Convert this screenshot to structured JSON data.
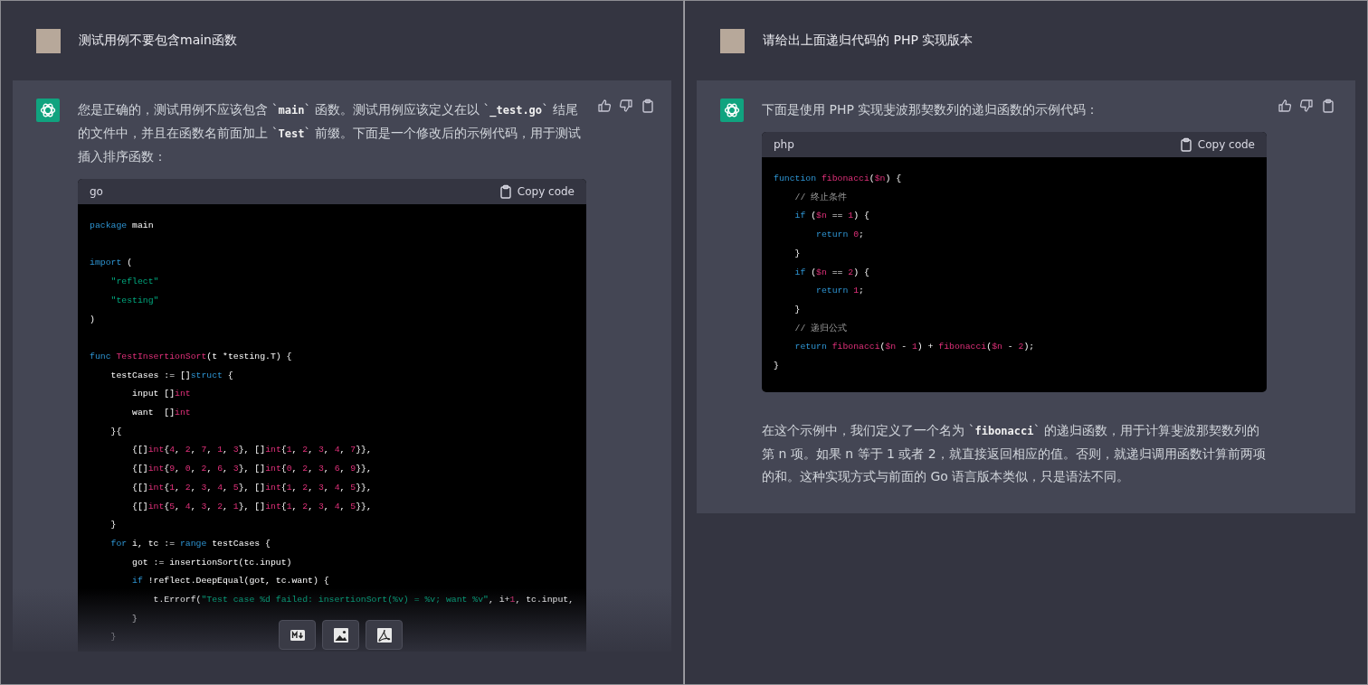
{
  "panels": [
    {
      "user_message": "测试用例不要包含main函数",
      "reply": {
        "intro": "您是正确的，测试用例不应该包含 `**main**` 函数。测试用例应该定义在以 `**_test.go**` 结尾的文件中，并且在函数名前面加上 `**Test**` 前缀。下面是一个修改后的示例代码，用于测试插入排序函数：",
        "code": {
          "language": "go",
          "copy_label": "Copy code",
          "lines": [
            {
              "tokens": [
                {
                  "kind": "kw",
                  "text": "package"
                },
                {
                  "kind": "p",
                  "text": " main"
                }
              ]
            },
            {
              "gap_before": true,
              "tokens": [
                {
                  "kind": "kw",
                  "text": "import"
                },
                {
                  "kind": "p",
                  "text": " ("
                }
              ]
            },
            {
              "tokens": [
                {
                  "kind": "str",
                  "text": "    \"reflect\""
                }
              ]
            },
            {
              "tokens": [
                {
                  "kind": "str",
                  "text": "    \"testing\""
                }
              ]
            },
            {
              "tokens": [
                {
                  "kind": "p",
                  "text": ")"
                }
              ]
            },
            {
              "gap_before": true,
              "tokens": [
                {
                  "kind": "kw",
                  "text": "func"
                },
                {
                  "kind": "fn",
                  "text": " TestInsertionSort"
                },
                {
                  "kind": "p",
                  "text": "(t *testing.T) {"
                }
              ]
            },
            {
              "tokens": [
                {
                  "kind": "p",
                  "text": "    testCases := []"
                },
                {
                  "kind": "kw",
                  "text": "struct"
                },
                {
                  "kind": "p",
                  "text": " {"
                }
              ]
            },
            {
              "tokens": [
                {
                  "kind": "p",
                  "text": "        input []"
                },
                {
                  "kind": "num",
                  "text": "int"
                }
              ]
            },
            {
              "tokens": [
                {
                  "kind": "p",
                  "text": "        want  []"
                },
                {
                  "kind": "num",
                  "text": "int"
                }
              ]
            },
            {
              "tokens": [
                {
                  "kind": "p",
                  "text": "    }{"
                }
              ]
            },
            {
              "tokens": [
                {
                  "kind": "p",
                  "text": "        {[]"
                },
                {
                  "kind": "num",
                  "text": "int"
                },
                {
                  "kind": "p",
                  "text": "{"
                },
                {
                  "kind": "num",
                  "text": "4"
                },
                {
                  "kind": "p",
                  "text": ", "
                },
                {
                  "kind": "num",
                  "text": "2"
                },
                {
                  "kind": "p",
                  "text": ", "
                },
                {
                  "kind": "num",
                  "text": "7"
                },
                {
                  "kind": "p",
                  "text": ", "
                },
                {
                  "kind": "num",
                  "text": "1"
                },
                {
                  "kind": "p",
                  "text": ", "
                },
                {
                  "kind": "num",
                  "text": "3"
                },
                {
                  "kind": "p",
                  "text": "}, []"
                },
                {
                  "kind": "num",
                  "text": "int"
                },
                {
                  "kind": "p",
                  "text": "{"
                },
                {
                  "kind": "num",
                  "text": "1"
                },
                {
                  "kind": "p",
                  "text": ", "
                },
                {
                  "kind": "num",
                  "text": "2"
                },
                {
                  "kind": "p",
                  "text": ", "
                },
                {
                  "kind": "num",
                  "text": "3"
                },
                {
                  "kind": "p",
                  "text": ", "
                },
                {
                  "kind": "num",
                  "text": "4"
                },
                {
                  "kind": "p",
                  "text": ", "
                },
                {
                  "kind": "num",
                  "text": "7"
                },
                {
                  "kind": "p",
                  "text": "}},"
                }
              ]
            },
            {
              "tokens": [
                {
                  "kind": "p",
                  "text": "        {[]"
                },
                {
                  "kind": "num",
                  "text": "int"
                },
                {
                  "kind": "p",
                  "text": "{"
                },
                {
                  "kind": "num",
                  "text": "9"
                },
                {
                  "kind": "p",
                  "text": ", "
                },
                {
                  "kind": "num",
                  "text": "0"
                },
                {
                  "kind": "p",
                  "text": ", "
                },
                {
                  "kind": "num",
                  "text": "2"
                },
                {
                  "kind": "p",
                  "text": ", "
                },
                {
                  "kind": "num",
                  "text": "6"
                },
                {
                  "kind": "p",
                  "text": ", "
                },
                {
                  "kind": "num",
                  "text": "3"
                },
                {
                  "kind": "p",
                  "text": "}, []"
                },
                {
                  "kind": "num",
                  "text": "int"
                },
                {
                  "kind": "p",
                  "text": "{"
                },
                {
                  "kind": "num",
                  "text": "0"
                },
                {
                  "kind": "p",
                  "text": ", "
                },
                {
                  "kind": "num",
                  "text": "2"
                },
                {
                  "kind": "p",
                  "text": ", "
                },
                {
                  "kind": "num",
                  "text": "3"
                },
                {
                  "kind": "p",
                  "text": ", "
                },
                {
                  "kind": "num",
                  "text": "6"
                },
                {
                  "kind": "p",
                  "text": ", "
                },
                {
                  "kind": "num",
                  "text": "9"
                },
                {
                  "kind": "p",
                  "text": "}},"
                }
              ]
            },
            {
              "tokens": [
                {
                  "kind": "p",
                  "text": "        {[]"
                },
                {
                  "kind": "num",
                  "text": "int"
                },
                {
                  "kind": "p",
                  "text": "{"
                },
                {
                  "kind": "num",
                  "text": "1"
                },
                {
                  "kind": "p",
                  "text": ", "
                },
                {
                  "kind": "num",
                  "text": "2"
                },
                {
                  "kind": "p",
                  "text": ", "
                },
                {
                  "kind": "num",
                  "text": "3"
                },
                {
                  "kind": "p",
                  "text": ", "
                },
                {
                  "kind": "num",
                  "text": "4"
                },
                {
                  "kind": "p",
                  "text": ", "
                },
                {
                  "kind": "num",
                  "text": "5"
                },
                {
                  "kind": "p",
                  "text": "}, []"
                },
                {
                  "kind": "num",
                  "text": "int"
                },
                {
                  "kind": "p",
                  "text": "{"
                },
                {
                  "kind": "num",
                  "text": "1"
                },
                {
                  "kind": "p",
                  "text": ", "
                },
                {
                  "kind": "num",
                  "text": "2"
                },
                {
                  "kind": "p",
                  "text": ", "
                },
                {
                  "kind": "num",
                  "text": "3"
                },
                {
                  "kind": "p",
                  "text": ", "
                },
                {
                  "kind": "num",
                  "text": "4"
                },
                {
                  "kind": "p",
                  "text": ", "
                },
                {
                  "kind": "num",
                  "text": "5"
                },
                {
                  "kind": "p",
                  "text": "}},"
                }
              ]
            },
            {
              "tokens": [
                {
                  "kind": "p",
                  "text": "        {[]"
                },
                {
                  "kind": "num",
                  "text": "int"
                },
                {
                  "kind": "p",
                  "text": "{"
                },
                {
                  "kind": "num",
                  "text": "5"
                },
                {
                  "kind": "p",
                  "text": ", "
                },
                {
                  "kind": "num",
                  "text": "4"
                },
                {
                  "kind": "p",
                  "text": ", "
                },
                {
                  "kind": "num",
                  "text": "3"
                },
                {
                  "kind": "p",
                  "text": ", "
                },
                {
                  "kind": "num",
                  "text": "2"
                },
                {
                  "kind": "p",
                  "text": ", "
                },
                {
                  "kind": "num",
                  "text": "1"
                },
                {
                  "kind": "p",
                  "text": "}, []"
                },
                {
                  "kind": "num",
                  "text": "int"
                },
                {
                  "kind": "p",
                  "text": "{"
                },
                {
                  "kind": "num",
                  "text": "1"
                },
                {
                  "kind": "p",
                  "text": ", "
                },
                {
                  "kind": "num",
                  "text": "2"
                },
                {
                  "kind": "p",
                  "text": ", "
                },
                {
                  "kind": "num",
                  "text": "3"
                },
                {
                  "kind": "p",
                  "text": ", "
                },
                {
                  "kind": "num",
                  "text": "4"
                },
                {
                  "kind": "p",
                  "text": ", "
                },
                {
                  "kind": "num",
                  "text": "5"
                },
                {
                  "kind": "p",
                  "text": "}},"
                }
              ]
            },
            {
              "tokens": [
                {
                  "kind": "p",
                  "text": "    }"
                }
              ]
            },
            {
              "tokens": [
                {
                  "kind": "kw",
                  "text": "    for"
                },
                {
                  "kind": "p",
                  "text": " i, tc := "
                },
                {
                  "kind": "kw",
                  "text": "range"
                },
                {
                  "kind": "p",
                  "text": " testCases {"
                }
              ]
            },
            {
              "tokens": [
                {
                  "kind": "p",
                  "text": "        got := insertionSort(tc.input)"
                }
              ]
            },
            {
              "tokens": [
                {
                  "kind": "kw",
                  "text": "        if"
                },
                {
                  "kind": "p",
                  "text": " !reflect.DeepEqual(got, tc.want) {"
                }
              ]
            },
            {
              "tokens": [
                {
                  "kind": "p",
                  "text": "            t.Errorf("
                },
                {
                  "kind": "str",
                  "text": "\"Test case %d failed: insertionSort(%v) = %v; want %v\""
                },
                {
                  "kind": "p",
                  "text": ", i+"
                },
                {
                  "kind": "num",
                  "text": "1"
                },
                {
                  "kind": "p",
                  "text": ", tc.input,"
                }
              ]
            },
            {
              "tokens": [
                {
                  "kind": "p",
                  "text": "        }"
                }
              ]
            },
            {
              "tokens": [
                {
                  "kind": "p",
                  "text": "    }"
                }
              ]
            }
          ]
        }
      },
      "export_toolbar": [
        {
          "kind": "markdown"
        },
        {
          "kind": "image"
        },
        {
          "kind": "pdf"
        }
      ]
    },
    {
      "user_message": "请给出上面递归代码的 PHP 实现版本",
      "reply": {
        "intro": "下面是使用 PHP 实现斐波那契数列的递归函数的示例代码：",
        "code": {
          "language": "php",
          "copy_label": "Copy code",
          "lines": [
            {
              "tokens": [
                {
                  "kind": "kw",
                  "text": "function"
                },
                {
                  "kind": "fn",
                  "text": " fibonacci"
                },
                {
                  "kind": "p",
                  "text": "("
                },
                {
                  "kind": "num",
                  "text": "$n"
                },
                {
                  "kind": "p",
                  "text": ") {"
                }
              ]
            },
            {
              "tokens": [
                {
                  "kind": "cm",
                  "text": "    // 终止条件"
                }
              ]
            },
            {
              "tokens": [
                {
                  "kind": "kw",
                  "text": "    if"
                },
                {
                  "kind": "p",
                  "text": " ("
                },
                {
                  "kind": "num",
                  "text": "$n"
                },
                {
                  "kind": "p",
                  "text": " == "
                },
                {
                  "kind": "num",
                  "text": "1"
                },
                {
                  "kind": "p",
                  "text": ") {"
                }
              ]
            },
            {
              "tokens": [
                {
                  "kind": "kw",
                  "text": "        return"
                },
                {
                  "kind": "num",
                  "text": " 0"
                },
                {
                  "kind": "p",
                  "text": ";"
                }
              ]
            },
            {
              "tokens": [
                {
                  "kind": "p",
                  "text": "    }"
                }
              ]
            },
            {
              "tokens": [
                {
                  "kind": "kw",
                  "text": "    if"
                },
                {
                  "kind": "p",
                  "text": " ("
                },
                {
                  "kind": "num",
                  "text": "$n"
                },
                {
                  "kind": "p",
                  "text": " == "
                },
                {
                  "kind": "num",
                  "text": "2"
                },
                {
                  "kind": "p",
                  "text": ") {"
                }
              ]
            },
            {
              "tokens": [
                {
                  "kind": "kw",
                  "text": "        return"
                },
                {
                  "kind": "num",
                  "text": " 1"
                },
                {
                  "kind": "p",
                  "text": ";"
                }
              ]
            },
            {
              "tokens": [
                {
                  "kind": "p",
                  "text": "    }"
                }
              ]
            },
            {
              "tokens": [
                {
                  "kind": "cm",
                  "text": "    // 递归公式"
                }
              ]
            },
            {
              "tokens": [
                {
                  "kind": "kw",
                  "text": "    return"
                },
                {
                  "kind": "fn",
                  "text": " fibonacci"
                },
                {
                  "kind": "p",
                  "text": "("
                },
                {
                  "kind": "num",
                  "text": "$n"
                },
                {
                  "kind": "p",
                  "text": " - "
                },
                {
                  "kind": "num",
                  "text": "1"
                },
                {
                  "kind": "p",
                  "text": ") + "
                },
                {
                  "kind": "fn",
                  "text": "fibonacci"
                },
                {
                  "kind": "p",
                  "text": "("
                },
                {
                  "kind": "num",
                  "text": "$n"
                },
                {
                  "kind": "p",
                  "text": " - "
                },
                {
                  "kind": "num",
                  "text": "2"
                },
                {
                  "kind": "p",
                  "text": ");"
                }
              ]
            },
            {
              "tokens": [
                {
                  "kind": "p",
                  "text": "}"
                }
              ]
            }
          ]
        },
        "outro": "在这个示例中，我们定义了一个名为 `**fibonacci**` 的递归函数，用于计算斐波那契数列的第 n 项。如果 n 等于 1 或者 2，就直接返回相应的值。否则，就递归调用函数计算前两项的和。这种实现方式与前面的 Go 语言版本类似，只是语法不同。"
      }
    }
  ]
}
